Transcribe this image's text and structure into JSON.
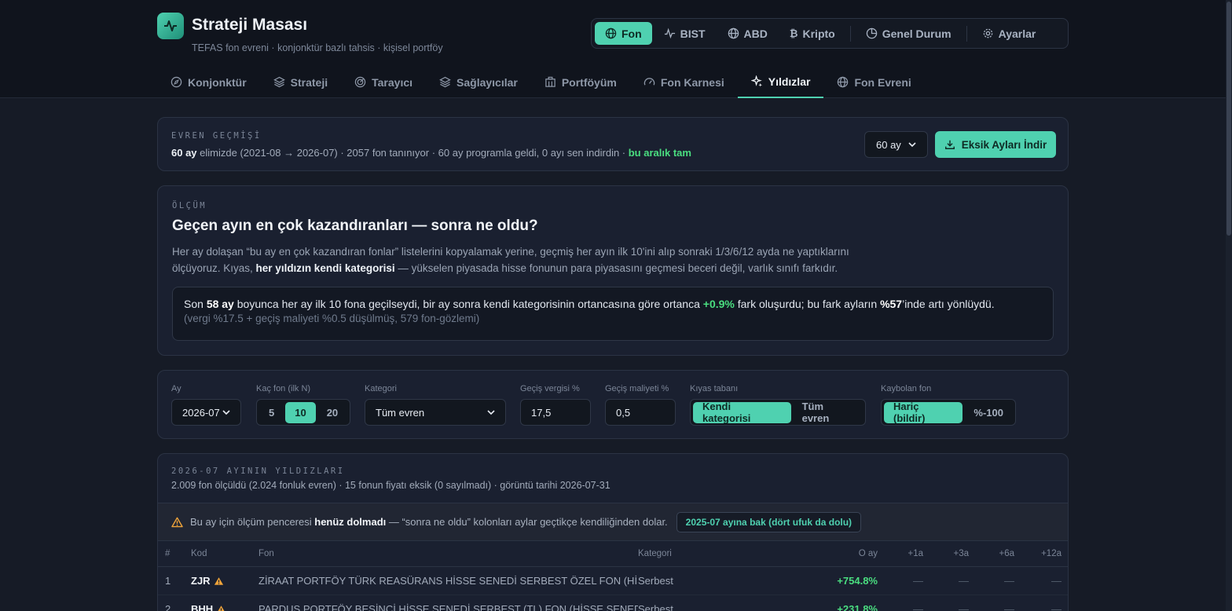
{
  "app": {
    "title": "Strateji Masası",
    "subtitle": "TEFAS fon evreni · konjonktür bazlı tahsis · kişisel portföy"
  },
  "markets": [
    {
      "label": "Fon",
      "icon": "globe-icon",
      "active": true
    },
    {
      "label": "BIST",
      "icon": "pulse-icon"
    },
    {
      "label": "ABD",
      "icon": "globe-icon"
    },
    {
      "label": "Kripto",
      "icon": "bitcoin-icon"
    },
    {
      "label": "Genel Durum",
      "icon": "pie-icon"
    },
    {
      "label": "Ayarlar",
      "icon": "gear-icon"
    }
  ],
  "tabs": [
    {
      "label": "Konjonktür",
      "icon": "compass-icon"
    },
    {
      "label": "Strateji",
      "icon": "layers-icon"
    },
    {
      "label": "Tarayıcı",
      "icon": "radar-icon"
    },
    {
      "label": "Sağlayıcılar",
      "icon": "layers-icon"
    },
    {
      "label": "Portföyüm",
      "icon": "building-icon"
    },
    {
      "label": "Fon Karnesi",
      "icon": "gauge-icon"
    },
    {
      "label": "Yıldızlar",
      "icon": "sparkle-icon",
      "active": true
    },
    {
      "label": "Fon Evreni",
      "icon": "globe-icon"
    }
  ],
  "history": {
    "label": "EVREN GEÇMİŞİ",
    "months_bold": "60 ay",
    "text": " elimizde (2021-08 → 2026-07) · 2057 fon tanınıyor · 60 ay programla geldi, 0 ayı sen indirdin · ",
    "status": "bu aralık tam",
    "select_value": "60 ay",
    "download_label": "Eksik Ayları İndir"
  },
  "measure": {
    "label": "ÖLÇÜM",
    "title": "Geçen ayın en çok kazandıranları — sonra ne oldu?",
    "desc_1": "Her ay dolaşan “bu ay en çok kazandıran fonlar” listelerini kopyalamak yerine, geçmiş her ayın ilk 10'ini alıp sonraki 1/3/6/12 ayda ne yaptıklarını ölçüyoruz. Kıyas, ",
    "desc_bold": "her yıldızın kendi kategorisi",
    "desc_2": " — yükselen piyasada hisse fonunun para piyasasını geçmesi beceri değil, varlık sınıfı farkıdır.",
    "result_a": "Son ",
    "result_months": "58 ay",
    "result_b": " boyunca her ay ilk 10 fona geçilseydi, bir ay sonra kendi kategorisinin ortancasına göre ortanca ",
    "result_pct": "+0.9%",
    "result_c": " fark oluşurdu; bu fark ayların ",
    "result_share": "%57",
    "result_d": "’inde artı yönlüydü.",
    "result_note": "(vergi %17.5 + geçiş maliyeti %0.5 düşülmüş, 579 fon-gözlemi)"
  },
  "filters": {
    "month_label": "Ay",
    "month_value": "2026-07",
    "n_label": "Kaç fon (ilk N)",
    "n_options": [
      "5",
      "10",
      "20"
    ],
    "n_active": "10",
    "category_label": "Kategori",
    "category_value": "Tüm evren",
    "tax_label": "Geçiş vergisi %",
    "tax_value": "17,5",
    "cost_label": "Geçiş maliyeti %",
    "cost_value": "0,5",
    "base_label": "Kıyas tabanı",
    "base_options": [
      "Kendi kategorisi",
      "Tüm evren"
    ],
    "base_active": "Kendi kategorisi",
    "lost_label": "Kaybolan fon",
    "lost_options": [
      "Hariç (bildir)",
      "%-100"
    ],
    "lost_active": "Hariç (bildir)"
  },
  "stars": {
    "label": "2026-07 AYININ YILDIZLARI",
    "meta": "2.009 fon ölçüldü (2.024 fonluk evren) · 15 fonun fiyatı eksik (0 sayılmadı) · görüntü tarihi 2026-07-31",
    "warn_a": "Bu ay için ölçüm penceresi ",
    "warn_bold": "henüz dolmadı",
    "warn_b": " — “sonra ne oldu” kolonları aylar geçtikçe kendiliğinden dolar.",
    "warn_button": "2025-07 ayına bak (dört ufuk da dolu)",
    "columns": [
      "#",
      "Kod",
      "Fon",
      "Kategori",
      "O ay",
      "+1a",
      "+3a",
      "+6a",
      "+12a"
    ],
    "rows": [
      {
        "rank": "1",
        "code": "ZJR",
        "fund": "ZİRAAT PORTFÖY TÜRK REASÜRANS HİSSE SENEDİ SERBEST ÖZEL FON (HİSS...",
        "category": "Serbest",
        "month": "+754.8%",
        "p1": "—",
        "p3": "—",
        "p6": "—",
        "p12": "—"
      },
      {
        "rank": "2",
        "code": "BHH",
        "fund": "PARDUS PORTFÖY BEŞİNCİ HİSSE SENEDİ SERBEST (TL) FON (HİSSE SENEDİ...",
        "category": "Serbest",
        "month": "+231.8%",
        "p1": "—",
        "p3": "—",
        "p6": "—",
        "p12": "—"
      }
    ]
  },
  "colors": {
    "accent": "#4fd1b0",
    "positive": "#4ade80",
    "warning": "#f0a43a",
    "background": "#161b26"
  }
}
